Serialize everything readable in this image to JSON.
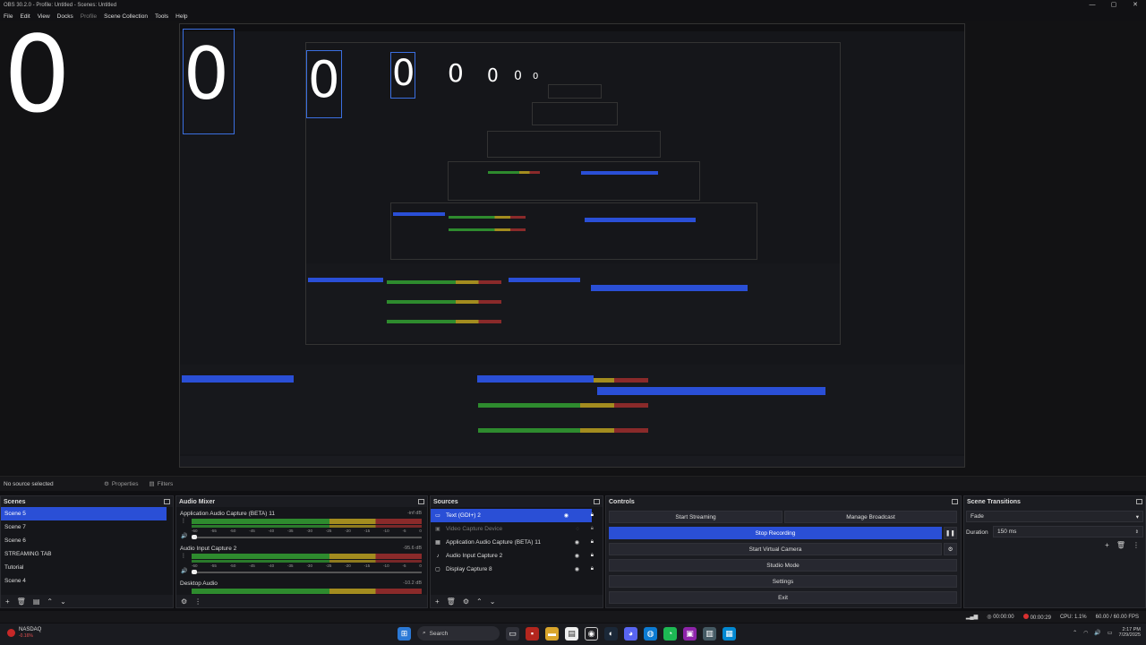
{
  "window": {
    "title": "OBS 30.2.0 - Profile: Untitled - Scenes: Untitled",
    "controls": [
      "—",
      "▢",
      "✕"
    ]
  },
  "menu": {
    "file": "File",
    "edit": "Edit",
    "view": "View",
    "docks": "Docks",
    "profile": "Profile",
    "scene_collection": "Scene Collection",
    "tools": "Tools",
    "help": "Help"
  },
  "preview": {
    "counter_value": "0"
  },
  "status_row": {
    "no_source": "No source selected",
    "properties": "Properties",
    "filters": "Filters"
  },
  "scenes": {
    "title": "Scenes",
    "items": [
      "Scene 5",
      "Scene 7",
      "Scene 6",
      "STREAMING TAB",
      "Tutorial",
      "Scene 4"
    ],
    "selected_index": 0
  },
  "audio_mixer": {
    "title": "Audio Mixer",
    "channels": [
      {
        "name": "Application Audio Capture (BETA) 11",
        "db": "-inf dB"
      },
      {
        "name": "Audio Input Capture 2",
        "db": "-95.6 dB"
      },
      {
        "name": "Desktop Audio",
        "db": "-10.2 dB"
      }
    ],
    "ticks": [
      "-60",
      "-55",
      "-50",
      "-45",
      "-40",
      "-35",
      "-30",
      "-25",
      "-20",
      "-15",
      "-10",
      "-5",
      "0"
    ]
  },
  "sources": {
    "title": "Sources",
    "items": [
      {
        "name": "Text (GDI+) 2",
        "icon": "text-icon",
        "state": "selected"
      },
      {
        "name": "Video Capture Device",
        "icon": "camera-icon",
        "state": "hidden"
      },
      {
        "name": "Application Audio Capture (BETA) 11",
        "icon": "app-audio-icon",
        "state": "normal"
      },
      {
        "name": "Audio Input Capture 2",
        "icon": "microphone-icon",
        "state": "normal"
      },
      {
        "name": "Display Capture 8",
        "icon": "monitor-icon",
        "state": "normal"
      }
    ]
  },
  "controls": {
    "title": "Controls",
    "start_streaming": "Start Streaming",
    "manage_broadcast": "Manage Broadcast",
    "stop_recording": "Stop Recording",
    "start_virtual_camera": "Start Virtual Camera",
    "studio_mode": "Studio Mode",
    "settings": "Settings",
    "exit": "Exit"
  },
  "scene_transitions": {
    "title": "Scene Transitions",
    "transition": "Fade",
    "duration_label": "Duration",
    "duration_value": "150 ms"
  },
  "obs_status": {
    "stream_time": "00:00:00",
    "rec_time": "00:00:29",
    "cpu": "CPU: 1.1%",
    "fps": "60.00 / 60.00 FPS"
  },
  "taskbar": {
    "ticker_name": "NASDAQ",
    "ticker_change": "-0.16%",
    "search_label": "Search",
    "time": "2:17 PM",
    "date": "7/29/2025"
  },
  "colors": {
    "accent": "#2a4fd6",
    "recording": "#d93030",
    "meter_green": "#2e8b2e",
    "meter_yellow": "#a38c1f",
    "meter_red": "#8a2a2a"
  }
}
